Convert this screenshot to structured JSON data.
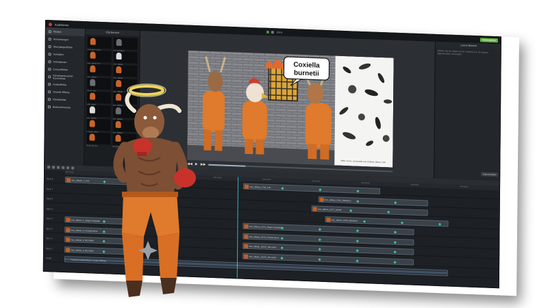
{
  "window": {
    "app_name": "Audiofarme",
    "zoom": "100%",
    "share_label": "Weitergeben"
  },
  "tools": [
    {
      "label": "Medien",
      "icon": "media-icon"
    },
    {
      "label": "Anmerkungen",
      "icon": "annotation-icon"
    },
    {
      "label": "Übergangseffekte",
      "icon": "transition-icon"
    },
    {
      "label": "Verhalten",
      "icon": "behavior-icon"
    },
    {
      "label": "Animationen",
      "icon": "animation-icon"
    },
    {
      "label": "Cursoreffekte",
      "icon": "cursor-icon"
    },
    {
      "label": "Sprachgesteuerter Kommentar",
      "icon": "voice-icon"
    },
    {
      "label": "Audioeffekte",
      "icon": "audio-icon"
    },
    {
      "label": "Visuelle Effekte",
      "icon": "visual-effects-icon"
    },
    {
      "label": "Interaktivität",
      "icon": "interactive-icon"
    },
    {
      "label": "Bedienelemente",
      "icon": "controls-icon"
    }
  ],
  "media_bin": {
    "title": "Clip Bereich",
    "items": [
      {
        "label": "A-Frieden-Lump..."
      },
      {
        "label": "S0_ausgaben"
      },
      {
        "label": "msc_aflstan_00..."
      },
      {
        "label": "msc_aflstan"
      },
      {
        "label": "msc_aflstan..."
      },
      {
        "label": "msc_aflstan..."
      },
      {
        "label": "S0_hi_mint..."
      },
      {
        "label": "msc_aflstan..."
      },
      {
        "label": "sdfe_arsde"
      },
      {
        "label": "msc_aflstan..."
      },
      {
        "label": "msc_aflstan..."
      },
      {
        "label": "msc_aflstan..."
      },
      {
        "label": "s_thuck_aflsta..."
      },
      {
        "label": "msc_aflstan..."
      },
      {
        "label": "Hoch_afl_Lip..."
      },
      {
        "label": "S0_ausgaben"
      }
    ]
  },
  "stage": {
    "speech_bubble_line1": "Coxiella",
    "speech_bubble_line2": "burnetii",
    "caption": "EMS: H.Krz, Universität Lab Institute, Bieuw, Vdh"
  },
  "properties": {
    "title": "Leerer Bereich",
    "hint": "Wählen Sie ein Objekt auf der Timeline aus, um dessen Eigenschaften anzuzeigen.",
    "button": "Eigenschaften"
  },
  "timeline": {
    "ruler_ticks": [
      "0:00:00;00",
      "0:00:05;00",
      "0:00:10;00",
      "0:00:15;00",
      "0:00:20;00",
      "0:00:25;00",
      "0:00:30;00",
      "0:00:35;00",
      "0:00:40;00"
    ],
    "tracks": [
      {
        "label": "Spur 8",
        "clips": [
          {
            "label": "msc_aflstan_2_Kuh"
          },
          {
            "label": "msc_aflstan_0732_Kuh"
          }
        ]
      },
      {
        "label": "Spur 7",
        "clips": [
          {
            "label": "msc_aflstan_0210_Bakterien"
          }
        ]
      },
      {
        "label": "Spur 6",
        "clips": [
          {
            "label": "msc_aflstan_0077_Schrift"
          }
        ]
      },
      {
        "label": "Spur 5",
        "clips": [
          {
            "label": "msc_aflstan_0318_Bakterien"
          }
        ]
      },
      {
        "label": "Spur 4",
        "clips": [
          {
            "label": "msc_aflstan_2_Ziegen-Dartpfeil"
          },
          {
            "label": "msc_aflstan_0074_Ziegen-Dartpfeil"
          }
        ]
      },
      {
        "label": "Spur 3",
        "clips": [
          {
            "label": "msc_aflstan_2_Fenster-Blum"
          },
          {
            "label": "msc_aflstan_0073_Fenster-Blum"
          }
        ]
      },
      {
        "label": "Spur 2",
        "clips": [
          {
            "label": "msc_aflstan_2_BG-Gitter"
          },
          {
            "label": "msc_aflstan_20070_BG-Gitter"
          }
        ]
      },
      {
        "label": "Spur 1",
        "clips": [
          {
            "label": "msc_aflstan_2_BG-Gitter"
          },
          {
            "label": "msc_aflstan_20070_BG-Gitter"
          }
        ]
      },
      {
        "label": "Audio",
        "clips": [
          {
            "label": "Frieden-Lumpenaflstan-Lumpa-Ribbles"
          }
        ]
      }
    ]
  },
  "colors": {
    "accent": "#5fb33c",
    "playhead": "#2bb5c9",
    "keyframe": "#3fc1a8",
    "jumpsuit": "#e07a2c"
  }
}
